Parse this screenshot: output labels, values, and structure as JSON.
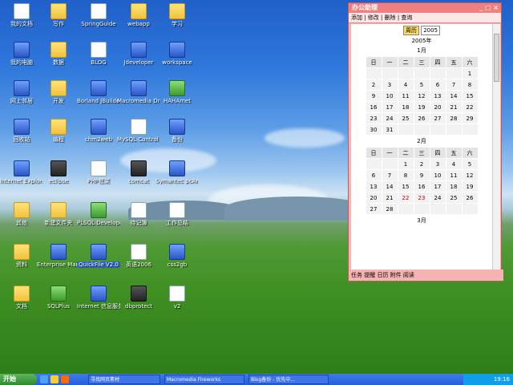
{
  "desktop_icons": [
    {
      "label": "我的文档",
      "kind": "doc"
    },
    {
      "label": "写作",
      "kind": "folder"
    },
    {
      "label": "SpringGuide",
      "kind": "doc"
    },
    {
      "label": "webapp",
      "kind": "folder"
    },
    {
      "label": "学习",
      "kind": "folder"
    },
    {
      "label": "我的电脑",
      "kind": "app"
    },
    {
      "label": "数据",
      "kind": "folder"
    },
    {
      "label": "BLOG",
      "kind": "doc"
    },
    {
      "label": "Jdeveloper",
      "kind": "app"
    },
    {
      "label": "workspace",
      "kind": "app"
    },
    {
      "label": "网上邻居",
      "kind": "app"
    },
    {
      "label": "开发",
      "kind": "folder"
    },
    {
      "label": "Borland JBuilder 20...",
      "kind": "app"
    },
    {
      "label": "Macromedia Dreamwea...",
      "kind": "app"
    },
    {
      "label": "HAHAmet",
      "kind": "green"
    },
    {
      "label": "回收站",
      "kind": "app"
    },
    {
      "label": "编程",
      "kind": "folder"
    },
    {
      "label": "chm2web",
      "kind": "app"
    },
    {
      "label": "MySQL Control Center",
      "kind": "doc"
    },
    {
      "label": "备份",
      "kind": "app"
    },
    {
      "label": "Internet Explorer",
      "kind": "app"
    },
    {
      "label": "eclipse",
      "kind": "dark"
    },
    {
      "label": "PHP框架",
      "kind": "doc"
    },
    {
      "label": "comcat",
      "kind": "dark"
    },
    {
      "label": "Symantec pcAnywhere",
      "kind": "app"
    },
    {
      "label": "其他",
      "kind": "folder"
    },
    {
      "label": "新建文件夹",
      "kind": "folder"
    },
    {
      "label": "PLSQL Developer",
      "kind": "green"
    },
    {
      "label": "待记簿",
      "kind": "doc"
    },
    {
      "label": "工作总结",
      "kind": "doc"
    },
    {
      "label": "资料",
      "kind": "folder"
    },
    {
      "label": "Enterprise Manag...",
      "kind": "app"
    },
    {
      "label": "QuickFile V2.0",
      "kind": "app"
    },
    {
      "label": "英语2006",
      "kind": "doc"
    },
    {
      "label": "css2gb",
      "kind": "app"
    },
    {
      "label": "文档",
      "kind": "folder"
    },
    {
      "label": "SQLPlus",
      "kind": "green"
    },
    {
      "label": "Internet 信息服务",
      "kind": "app"
    },
    {
      "label": "dbprotect",
      "kind": "dark"
    },
    {
      "label": "v2",
      "kind": "doc"
    }
  ],
  "widget": {
    "title": "办公助理",
    "controls": "_ □ ×",
    "toolbar": "添加 | 修改 | 删除 | 查询",
    "calendar_type": "周历",
    "year": "2005",
    "year_label": "2005年",
    "weekdays": [
      "日",
      "一",
      "二",
      "三",
      "四",
      "五",
      "六"
    ],
    "months": [
      {
        "label": "1月",
        "rows": [
          [
            "",
            "",
            "",
            "",
            "",
            "",
            "1"
          ],
          [
            "2",
            "3",
            "4",
            "5",
            "6",
            "7",
            "8"
          ],
          [
            "9",
            "10",
            "11",
            "12",
            "13",
            "14",
            "15"
          ],
          [
            "16",
            "17",
            "18",
            "19",
            "20",
            "21",
            "22"
          ],
          [
            "23",
            "24",
            "25",
            "26",
            "27",
            "28",
            "29"
          ],
          [
            "30",
            "31",
            "",
            "",
            "",
            "",
            ""
          ]
        ]
      },
      {
        "label": "2月",
        "rows": [
          [
            "",
            "",
            "1",
            "2",
            "3",
            "4",
            "5"
          ],
          [
            "6",
            "7",
            "8",
            "9",
            "10",
            "11",
            "12"
          ],
          [
            "13",
            "14",
            "15",
            "16",
            "17",
            "18",
            "19"
          ],
          [
            "20",
            "21",
            "22",
            "23",
            "24",
            "25",
            "26"
          ],
          [
            "27",
            "28",
            "",
            "",
            "",
            "",
            ""
          ]
        ]
      }
    ],
    "next_month": "3月",
    "highlight_days": [
      "22",
      "23"
    ],
    "tabs": "任务  提醒  日历  附件  阅读"
  },
  "taskbar": {
    "start": "开始",
    "tasks": [
      "寻找网页素材",
      "Macromedia Fireworks",
      "Blog备份 - 优先中..."
    ],
    "time": "19:16"
  }
}
